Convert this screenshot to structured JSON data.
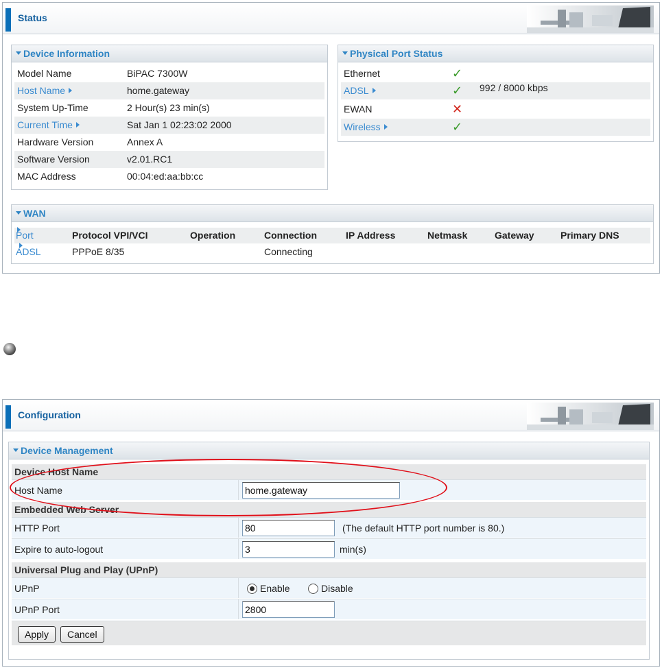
{
  "status": {
    "title": "Status",
    "device_info": {
      "title": "Device Information",
      "rows": [
        {
          "label": "Model Name",
          "value": "BiPAC 7300W"
        },
        {
          "label": "Host Name",
          "value": "home.gateway"
        },
        {
          "label": "System Up-Time",
          "value": "2 Hour(s) 23 min(s)"
        },
        {
          "label": "Current Time",
          "value": "Sat Jan 1 02:23:02 2000"
        },
        {
          "label": "Hardware Version",
          "value": "Annex A"
        },
        {
          "label": "Software Version",
          "value": "v2.01.RC1"
        },
        {
          "label": "MAC Address",
          "value": "00:04:ed:aa:bb:cc"
        }
      ]
    },
    "port_status": {
      "title": "Physical Port Status",
      "rows": [
        {
          "label": "Ethernet",
          "state": "check-icon",
          "detail": ""
        },
        {
          "label": "ADSL",
          "state": "check-icon",
          "detail": "992 / 8000 kbps"
        },
        {
          "label": "EWAN",
          "state": "cross-icon",
          "detail": ""
        },
        {
          "label": "Wireless",
          "state": "check-icon",
          "detail": ""
        }
      ]
    },
    "wan": {
      "title": "WAN",
      "columns": [
        "Port",
        "Protocol VPI/VCI",
        "Operation",
        "Connection",
        "IP Address",
        "Netmask",
        "Gateway",
        "Primary DNS"
      ],
      "rows": [
        {
          "port": "ADSL",
          "protocol": "PPPoE 8/35",
          "operation": "",
          "connection": "Connecting",
          "ip": "",
          "netmask": "",
          "gateway": "",
          "dns": ""
        }
      ]
    }
  },
  "config": {
    "title": "Configuration",
    "section_title": "Device Management",
    "groups": {
      "host": "Device Host Name",
      "web": "Embedded Web Server",
      "upnp": "Universal Plug and Play (UPnP)"
    },
    "fields": {
      "host_name_label": "Host Name",
      "host_name_value": "home.gateway",
      "http_port_label": "HTTP Port",
      "http_port_value": "80",
      "http_port_note": "(The default HTTP port number is 80.)",
      "logout_label": "Expire to auto-logout",
      "logout_value": "3",
      "logout_unit": "min(s)",
      "upnp_label": "UPnP",
      "upnp_enable": "Enable",
      "upnp_disable": "Disable",
      "upnp_selected": "Enable",
      "upnp_port_label": "UPnP Port",
      "upnp_port_value": "2800"
    },
    "buttons": {
      "apply": "Apply",
      "cancel": "Cancel"
    }
  },
  "colors": {
    "accent": "#0b6fb8",
    "link": "#3a8bd0",
    "highlight": "#e0101a"
  }
}
